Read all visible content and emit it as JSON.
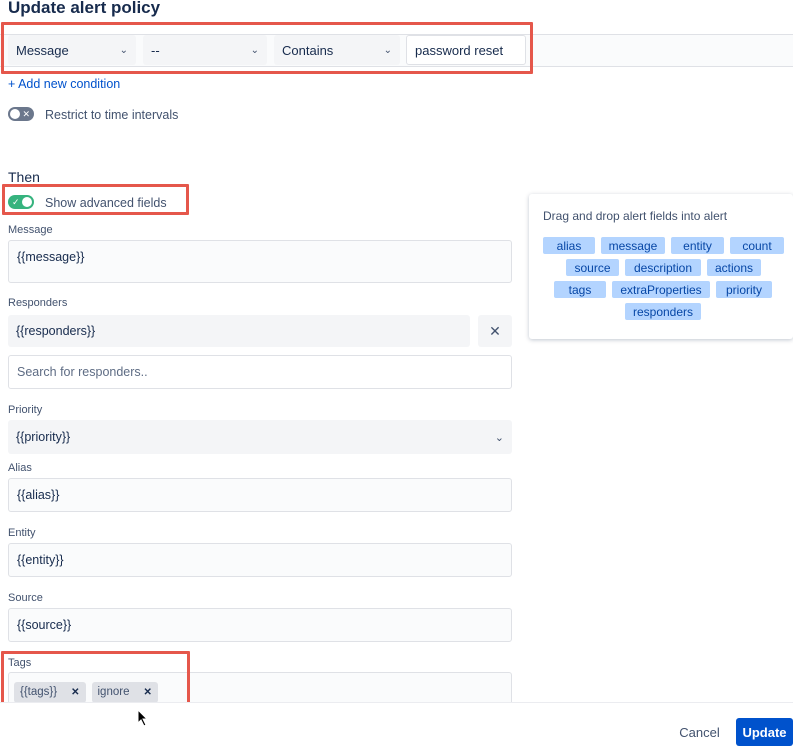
{
  "page": {
    "title": "Update alert policy"
  },
  "condition": {
    "field": "Message",
    "operator_not": "--",
    "operator": "Contains",
    "value": "password reset",
    "chevron": "chevron-down-icon"
  },
  "add_condition": "+ Add new condition",
  "restrict_time": {
    "label": "Restrict to time intervals",
    "on": false
  },
  "then": {
    "heading": "Then",
    "advanced_toggle": {
      "label": "Show advanced fields",
      "on": true
    }
  },
  "fields": {
    "message": {
      "label": "Message",
      "value": "{{message}}"
    },
    "responders": {
      "label": "Responders",
      "value": "{{responders}}",
      "search_placeholder": "Search for responders.."
    },
    "priority": {
      "label": "Priority",
      "value": "{{priority}}"
    },
    "alias": {
      "label": "Alias",
      "value": "{{alias}}"
    },
    "entity": {
      "label": "Entity",
      "value": "{{entity}}"
    },
    "source": {
      "label": "Source",
      "value": "{{source}}"
    },
    "tags": {
      "label": "Tags",
      "items": [
        "{{tags}}",
        "ignore"
      ]
    }
  },
  "panel": {
    "title": "Drag and drop alert fields into alert",
    "fields": [
      "alias",
      "message",
      "entity",
      "count",
      "source",
      "description",
      "actions",
      "tags",
      "extraProperties",
      "priority",
      "responders"
    ]
  },
  "footer": {
    "cancel": "Cancel",
    "update": "Update"
  },
  "colors": {
    "accent": "#0052cc",
    "pill": "#b3d4ff",
    "highlight": "#e5574b",
    "toggle_on": "#36b37e"
  }
}
